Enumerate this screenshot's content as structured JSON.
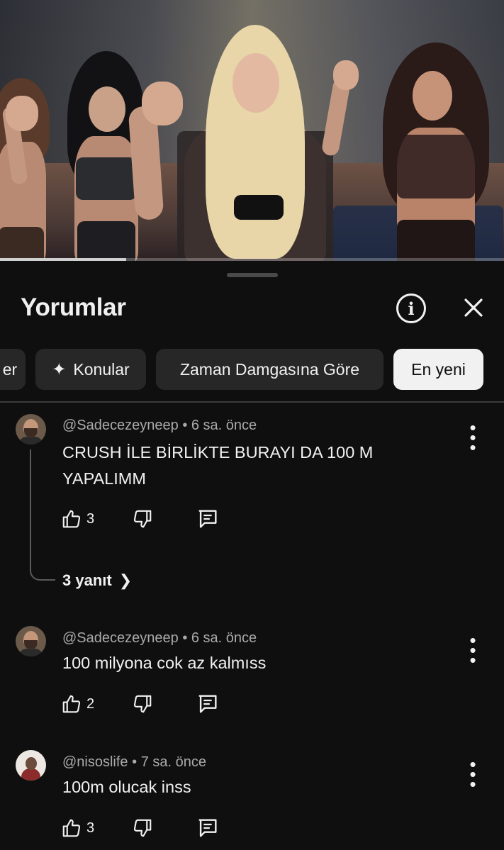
{
  "video": {
    "progress_fraction": 0.25
  },
  "panel": {
    "title": "Yorumlar",
    "info_icon": "info-circle-icon",
    "close_icon": "close-icon"
  },
  "chips": [
    {
      "label": "er",
      "active": false
    },
    {
      "label": "Konular",
      "icon": "sparkle-icon",
      "active": false
    },
    {
      "label": "Zaman Damgasına Göre",
      "active": false
    },
    {
      "label": "En yeni",
      "active": true
    }
  ],
  "comments": [
    {
      "author": "@Sadecezeyneep",
      "time": "6 sa. önce",
      "text": "CRUSH İLE BİRLİKTE BURAYI DA 100 M YAPALIMM",
      "likes": "3",
      "replies_label": "3 yanıt"
    },
    {
      "author": "@Sadecezeyneep",
      "time": "6 sa. önce",
      "text": "100 milyona cok az kalmıss",
      "likes": "2"
    },
    {
      "author": "@nisoslife",
      "time": "7 sa. önce",
      "text": "100m olucak inss",
      "likes": "3"
    }
  ]
}
